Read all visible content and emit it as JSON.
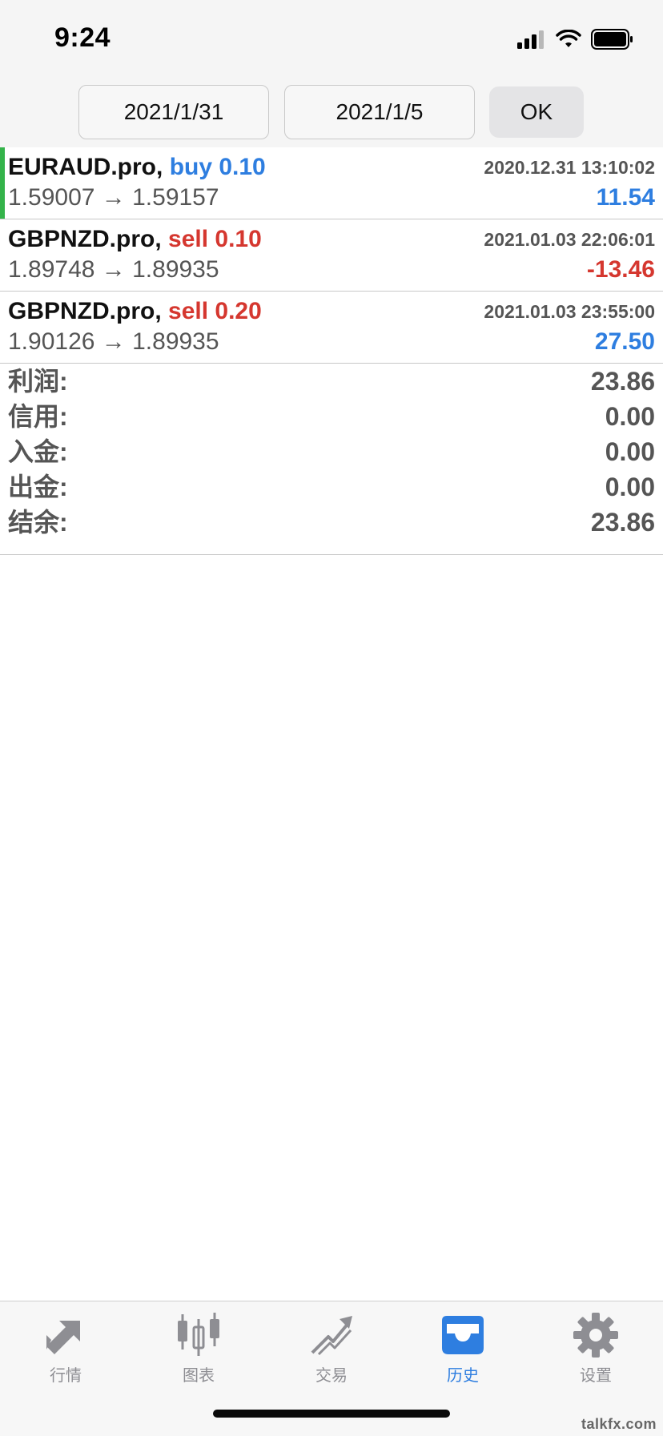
{
  "status_bar": {
    "time": "9:24"
  },
  "filter": {
    "date_from": "2021/1/31",
    "date_to": "2021/1/5",
    "ok_label": "OK"
  },
  "deals": [
    {
      "symbol": "EURAUD.pro,",
      "side": "buy 0.10",
      "time": "2020.12.31 13:10:02",
      "prices": "1.59007 → 1.59157",
      "profit": "11.54"
    },
    {
      "symbol": "GBPNZD.pro,",
      "side": "sell 0.10",
      "time": "2021.01.03 22:06:01",
      "prices": "1.89748 → 1.89935",
      "profit": "-13.46"
    },
    {
      "symbol": "GBPNZD.pro,",
      "side": "sell 0.20",
      "time": "2021.01.03 23:55:00",
      "prices": "1.90126 → 1.89935",
      "profit": "27.50"
    }
  ],
  "summary": [
    {
      "label": "利润:",
      "value": "23.86"
    },
    {
      "label": "信用:",
      "value": "0.00"
    },
    {
      "label": "入金:",
      "value": "0.00"
    },
    {
      "label": "出金:",
      "value": "0.00"
    },
    {
      "label": "结余:",
      "value": "23.86"
    }
  ],
  "tabs": [
    {
      "label": "行情",
      "icon": "quotes-arrows-icon"
    },
    {
      "label": "图表",
      "icon": "candlestick-chart-icon"
    },
    {
      "label": "交易",
      "icon": "trade-chart-icon"
    },
    {
      "label": "历史",
      "icon": "history-inbox-icon",
      "active": true
    },
    {
      "label": "设置",
      "icon": "gear-icon"
    }
  ],
  "watermark": "talkfx.com",
  "colors": {
    "accent_blue": "#2e7ee0",
    "loss_red": "#d5372f",
    "selected_green": "#34b34a"
  }
}
